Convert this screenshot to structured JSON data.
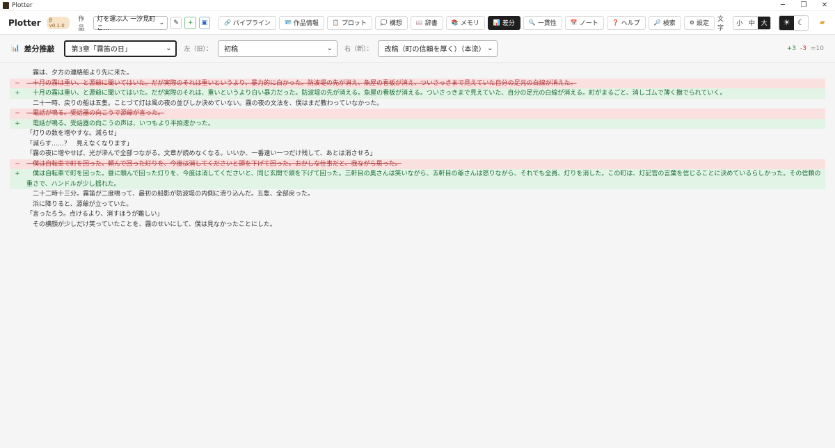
{
  "window": {
    "title": "Plotter"
  },
  "toolbar": {
    "brand": "Plotter",
    "version": "β v0.1.0",
    "work_label": "作品",
    "work_value": "灯を運ぶ人 一汐見町こ...",
    "tabs": [
      {
        "icon": "🔗",
        "label": "パイプライン",
        "active": false
      },
      {
        "icon": "🪪",
        "label": "作品情報",
        "active": false
      },
      {
        "icon": "📋",
        "label": "プロット",
        "active": false
      },
      {
        "icon": "💭",
        "label": "構想",
        "active": false
      },
      {
        "icon": "📖",
        "label": "辞書",
        "active": false
      },
      {
        "icon": "📚",
        "label": "メモリ",
        "active": false
      },
      {
        "icon": "📊",
        "label": "差分",
        "active": true
      },
      {
        "icon": "🔍",
        "label": "一貫性",
        "active": false
      },
      {
        "icon": "📅",
        "label": "ノート",
        "active": false
      },
      {
        "icon": "❓",
        "label": "ヘルプ",
        "active": false
      },
      {
        "icon": "🔎",
        "label": "検索",
        "active": false
      },
      {
        "icon": "⚙",
        "label": "設定",
        "active": false
      }
    ],
    "font_label": "文字",
    "font_sizes": [
      "小",
      "中",
      "大"
    ],
    "font_active": "大"
  },
  "diff": {
    "title": "差分推敲",
    "chapter": "第3章「霧笛の日」",
    "left_label": "左（旧）：",
    "left_value": "初稿",
    "right_label": "右（新）：",
    "right_value": "改稿（町の信頼を厚く）（本流）",
    "stat_add": "+3",
    "stat_del": "-3",
    "stat_eq": "=10",
    "lines": [
      {
        "type": "eq",
        "mark": "",
        "text": "　霧は、夕方の連絡船より先に来た。"
      },
      {
        "type": "del",
        "mark": "−",
        "text": "　十月の霧は重い、と源爺に聞いてはいた。だが実際のそれは重いというより、暴力的に白かった。防波堤の先が消え、魚屋の看板が消え、ついさっきまで見えていた自分の足元の白線が消えた。"
      },
      {
        "type": "add",
        "mark": "+",
        "text": "　十月の霧は重い、と源爺に聞いてはいた。だが実際のそれは、重いというより白い暴力だった。防波堤の先が消える。魚屋の看板が消える。ついさっきまで見えていた、自分の足元の白線が消える。町がまるごと、消しゴムで薄く撫でられていく。"
      },
      {
        "type": "eq",
        "mark": "",
        "text": "　二十一時、戻りの船は五隻。ことづて灯は風の夜の並びしか決めていない。霧の夜の文法を、僕はまだ教わっていなかった。"
      },
      {
        "type": "del",
        "mark": "−",
        "text": "　電話が鳴る。受話器の向こうで源爺が言った。"
      },
      {
        "type": "add",
        "mark": "+",
        "text": "　電話が鳴る。受話器の向こうの声は、いつもより半拍速かった。"
      },
      {
        "type": "eq",
        "mark": "",
        "text": "「灯りの数を増やすな。減らせ」"
      },
      {
        "type": "eq",
        "mark": "",
        "text": "「減らす……？　見えなくなります」"
      },
      {
        "type": "eq",
        "mark": "",
        "text": "「霧の夜に増やせば、光が滲んで全部つながる。文章が読めなくなる。いいか、一番遠い一つだけ残して、あとは消させろ」"
      },
      {
        "type": "del",
        "mark": "−",
        "text": "　僕は自転車で町を回った。頼んで回った灯りを、今度は消してくださいと頭を下げて回った。おかしな仕事だと、我ながら思った。"
      },
      {
        "type": "add",
        "mark": "+",
        "text": "　僕は自転車で町を回った。昼に頼んで回った灯りを、今度は消してくださいと、同じ玄関で頭を下げて回った。三軒目の奥さんは笑いながら、五軒目の爺さんは怒りながら、それでも全員、灯りを消した。この町は、灯記官の言葉を信じることに決めているらしかった。その信頼の重さで、ハンドルが少し揺れた。"
      },
      {
        "type": "eq",
        "mark": "",
        "text": "　二十二時十三分。霧笛が二度鳴って、最初の船影が防波堤の内側に滑り込んだ。五隻、全部戻った。"
      },
      {
        "type": "eq",
        "mark": "",
        "text": "　浜に降りると、源爺が立っていた。"
      },
      {
        "type": "eq",
        "mark": "",
        "text": "「言ったろう。点けるより、消すほうが難しい」"
      },
      {
        "type": "eq",
        "mark": "",
        "text": "　その横顔が少しだけ笑っていたことを、霧のせいにして、僕は見なかったことにした。"
      }
    ]
  }
}
